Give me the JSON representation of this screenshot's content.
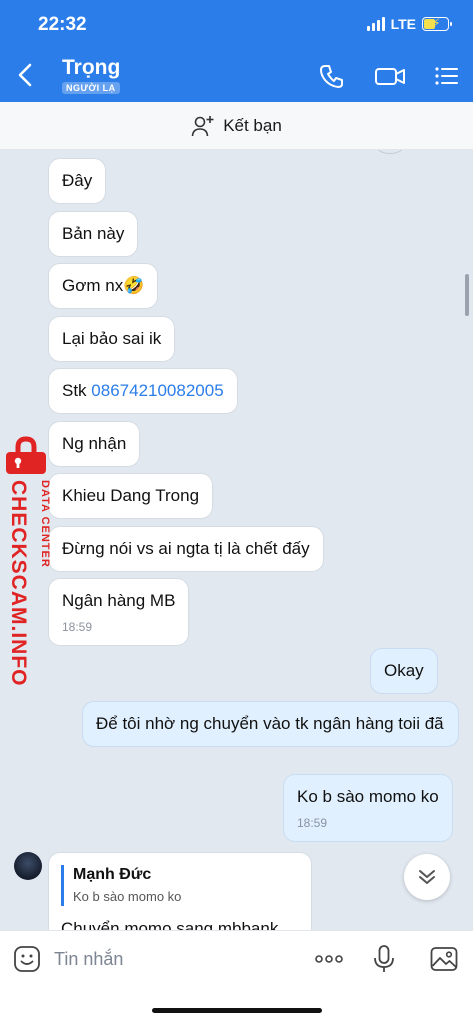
{
  "status_bar": {
    "time": "22:32",
    "network": "LTE"
  },
  "header": {
    "contact_name": "Trọng",
    "badge": "NGƯỜI LẠ",
    "icons": [
      "back-icon",
      "phone-icon",
      "video-call-icon",
      "menu-list-icon"
    ]
  },
  "add_friend": {
    "label": "Kết bạn"
  },
  "messages": [
    {
      "side": "left",
      "text": "Đây"
    },
    {
      "side": "left",
      "text": "Bản này"
    },
    {
      "side": "left",
      "text": "Gơm nx🤣"
    },
    {
      "side": "left",
      "text": "Lại bảo sai ik"
    },
    {
      "side": "left",
      "text_prefix": "Stk ",
      "link": "08674210082005"
    },
    {
      "side": "left",
      "text": "Ng nhận"
    },
    {
      "side": "left",
      "text": "Khieu Dang Trong"
    },
    {
      "side": "left",
      "text": "Đừng nói vs ai ngta tị là chết đấy"
    },
    {
      "side": "left",
      "text": "Ngân hàng MB",
      "time": "18:59"
    },
    {
      "side": "right",
      "text": "Okay"
    },
    {
      "side": "right",
      "text": "Để tôi nhờ ng chuyển vào tk ngân hàng toii đã"
    },
    {
      "side": "right",
      "text": "Ko b sào momo ko",
      "time": "18:59"
    }
  ],
  "reply_message": {
    "quoted_name": "Mạnh Đức",
    "quoted_text": "Ko b sào momo ko",
    "text": "Chuyển momo sang mbbank"
  },
  "watermark": {
    "line1": "DATA CENTER",
    "line2": "CHECKSCAM.INFO"
  },
  "input_bar": {
    "placeholder": "Tin nhắn",
    "icons": [
      "emoji-icon",
      "more-icon",
      "microphone-icon",
      "image-icon"
    ]
  },
  "colors": {
    "accent": "#2b7de9",
    "chat_background": "#e2e8f0",
    "outgoing_bubble": "#e1f0fe",
    "watermark": "#e02424"
  }
}
